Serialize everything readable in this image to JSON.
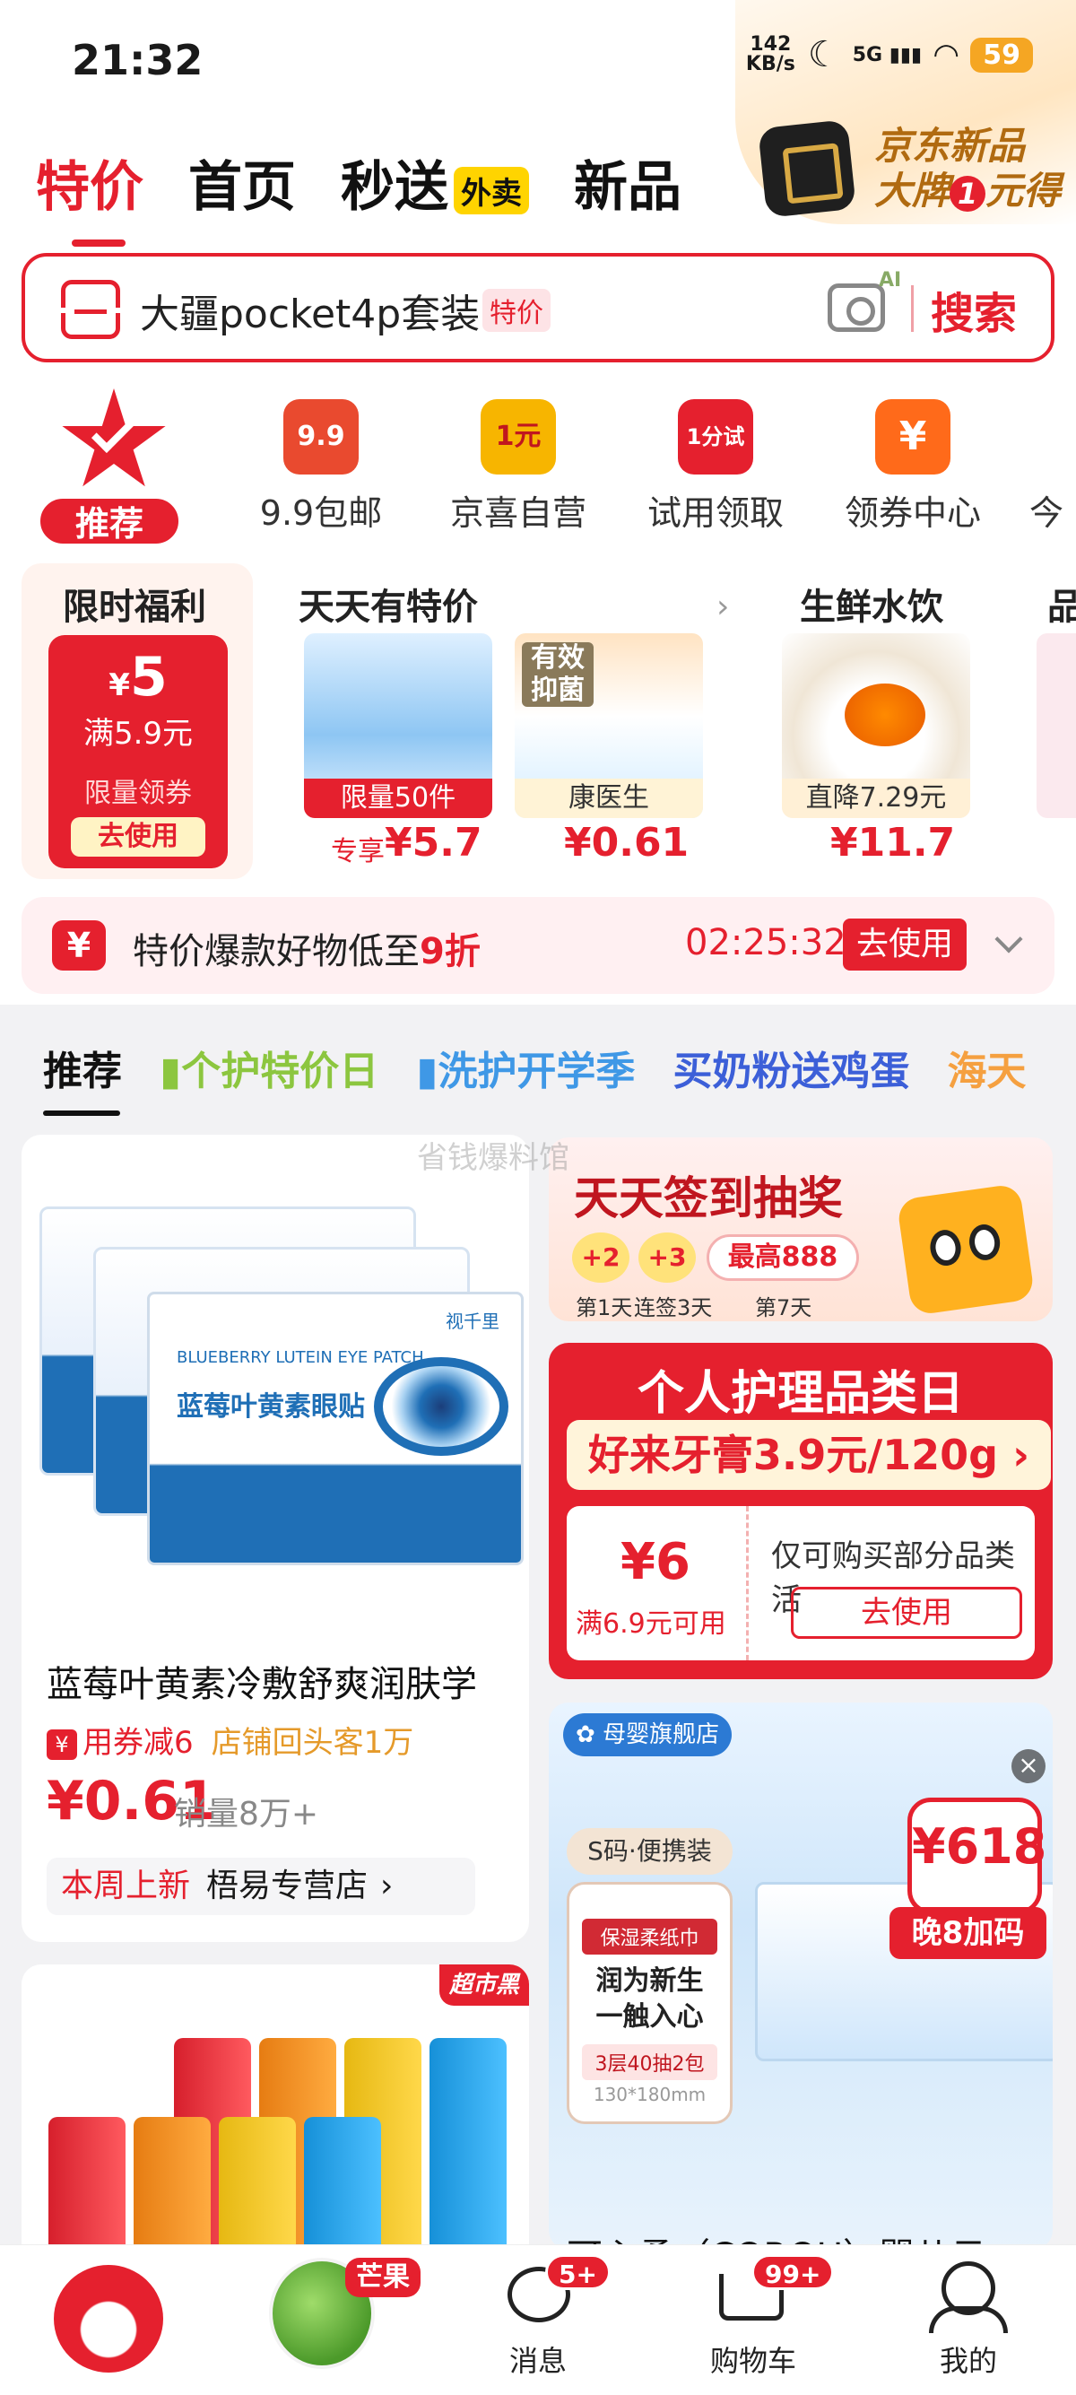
{
  "status": {
    "time": "21:32",
    "net_speed": "142",
    "net_unit": "KB/s",
    "signal": "5G",
    "battery": "59"
  },
  "topnav": {
    "tabs": [
      "特价",
      "首页",
      "秒送",
      "新品"
    ],
    "waimai_badge": "外卖"
  },
  "promo": {
    "line1": "京东新品",
    "line2_a": "大牌",
    "line2_num": "1",
    "line2_b": "元得"
  },
  "search": {
    "query": "大疆pocket4p套装",
    "tag": "特价",
    "ai_label": "AI",
    "button": "搜索"
  },
  "categories": {
    "active": "推荐",
    "items": [
      {
        "icon_text": "9.9",
        "label": "9.9包邮",
        "color": "#e94a2f"
      },
      {
        "icon_text": "1元",
        "label": "京喜自营",
        "color": "#f7b500"
      },
      {
        "icon_text": "1分试",
        "label": "试用领取",
        "color": "#e5202e"
      },
      {
        "icon_text": "¥",
        "label": "领券中心",
        "color": "#ff6a1a"
      },
      {
        "icon_text": "",
        "label": "今",
        "color": "#ffffff"
      }
    ]
  },
  "cards": {
    "welfare": {
      "title": "限时福利",
      "currency": "¥",
      "amount": "5",
      "condition": "满5.9元",
      "limit": "限量领券",
      "button": "去使用"
    },
    "daily": {
      "title": "天天有特价",
      "item1": {
        "tag": "限量50件",
        "prefix": "专享",
        "price": "¥5.7"
      },
      "item2": {
        "tag": "康医生",
        "price": "¥0.61",
        "img_text": "有效抑菌"
      }
    },
    "fresh": {
      "title": "生鲜水饮",
      "tag": "直降7.29元",
      "price": "¥11.7"
    },
    "more": {
      "title": "品"
    }
  },
  "banner": {
    "text_a": "特价爆款好物低至",
    "text_b": "9折",
    "timer": "02:25:32",
    "button": "去使用"
  },
  "feedtabs": [
    {
      "label": "推荐",
      "color": "#111111"
    },
    {
      "label": "个护特价日",
      "color": "#8cc63f"
    },
    {
      "label": "洗护开学季",
      "color": "#3f98e6"
    },
    {
      "label": "买奶粉送鸡蛋",
      "color": "#3c5fd8"
    },
    {
      "label": "海天",
      "color": "#f5a040"
    }
  ],
  "watermark": "省钱爆料馆",
  "feed": {
    "eyepatch": {
      "box_title": "蓝莓叶黄素眼贴",
      "box_sub": "BLUEBERRY LUTEIN EYE PATCH",
      "brand": "视千里",
      "title": "蓝莓叶黄素冷敷舒爽润肤学",
      "coupon": "用券减6",
      "returning": "店铺回头客1万",
      "price": "¥0.61",
      "sales": "销量8万+",
      "new_tag": "本周上新",
      "shop": "梧易专营店"
    },
    "signin": {
      "title": "天天签到抽奖",
      "coins": [
        {
          "v": "+2",
          "label": "第1天"
        },
        {
          "v": "+3",
          "label": "连签3天"
        }
      ],
      "max": "最高888",
      "max_label": "第7天"
    },
    "personal": {
      "title": "个人护理品类日",
      "sub": "好来牙膏3.9元/120g",
      "amount": "¥6",
      "condition": "满6.9元可用",
      "desc": "仅可购买部分品类活",
      "button": "去使用"
    },
    "copou": {
      "brand": "母婴旗舰店",
      "size": "S码·便携装",
      "pkg_top": "保湿柔纸巾",
      "pkg_main": "润为新生\n一触入心",
      "pkg_bot": "3层40抽2包",
      "pkg_size": "130*180mm",
      "badge": "¥618",
      "wan": "晚8加码",
      "title": "可心柔（COROU）婴儿云"
    },
    "battery": {
      "tag": "超市黑五"
    }
  },
  "bottomnav": {
    "mango_tag": "芒果",
    "msg": "消息",
    "msg_badge": "5+",
    "cart": "购物车",
    "cart_badge": "99+",
    "me": "我的"
  }
}
